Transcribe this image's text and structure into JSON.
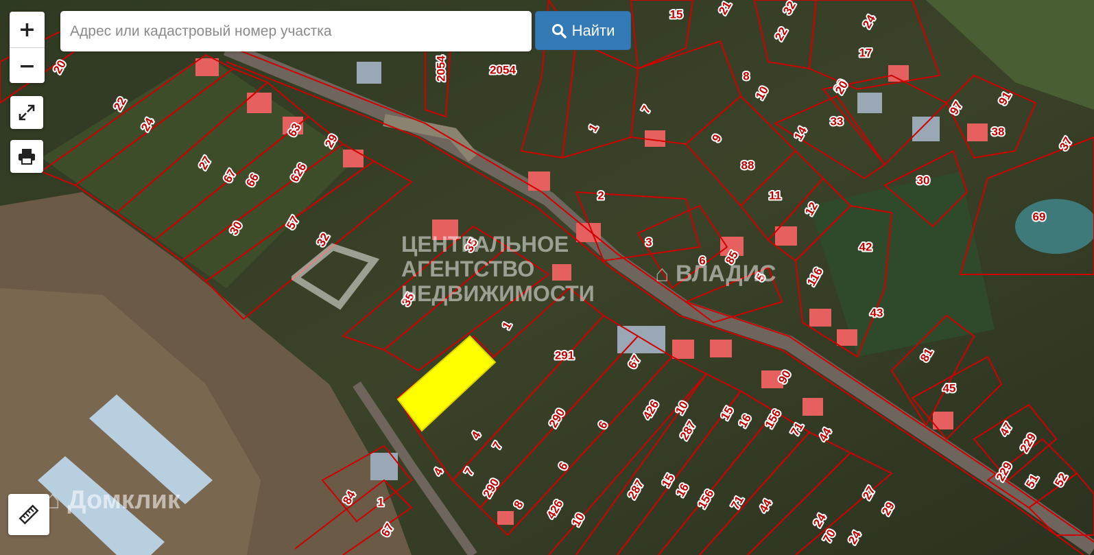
{
  "search": {
    "placeholder": "Адрес или кадастровый номер участка",
    "value": "",
    "button_label": "Найти"
  },
  "controls": {
    "zoom_in": "+",
    "zoom_out": "−"
  },
  "watermarks": {
    "agency_line1": "ЦЕНТРАЛЬНОЕ",
    "agency_line2": "АГЕНТСТВО",
    "agency_line3": "НЕДВИЖИМОСТИ",
    "vladis": "ВЛАДИС",
    "domclick": "Домклик"
  },
  "parcel_labels": [
    "21",
    "32",
    "15",
    "24",
    "22",
    "20",
    "17",
    "2054",
    "2054",
    "8",
    "22",
    "20",
    "24",
    "63",
    "29",
    "10",
    "7",
    "1",
    "33",
    "20",
    "97",
    "91",
    "14",
    "38",
    "27",
    "67",
    "66",
    "626",
    "9",
    "88",
    "37",
    "30",
    "11",
    "12",
    "30",
    "57",
    "32",
    "2",
    "69",
    "35",
    "3",
    "6",
    "85",
    "116",
    "42",
    "35",
    "1",
    "5",
    "43",
    "291",
    "67",
    "81",
    "45",
    "90",
    "4",
    "7",
    "290",
    "6",
    "426",
    "10",
    "287",
    "15",
    "16",
    "156",
    "71",
    "44",
    "47",
    "229",
    "4",
    "7",
    "290",
    "6",
    "8",
    "426",
    "10",
    "287",
    "15",
    "16",
    "156",
    "71",
    "44",
    "27",
    "229",
    "51",
    "52",
    "84",
    "1",
    "67",
    "29",
    "24",
    "70",
    "24"
  ],
  "colors": {
    "parcel_border": "#d00000",
    "highlight_parcel": "#ffff00",
    "search_button": "#337ab7"
  },
  "icons": {
    "search": "search-icon",
    "fullscreen": "fullscreen-icon",
    "print": "printer-icon",
    "ruler": "ruler-icon"
  }
}
